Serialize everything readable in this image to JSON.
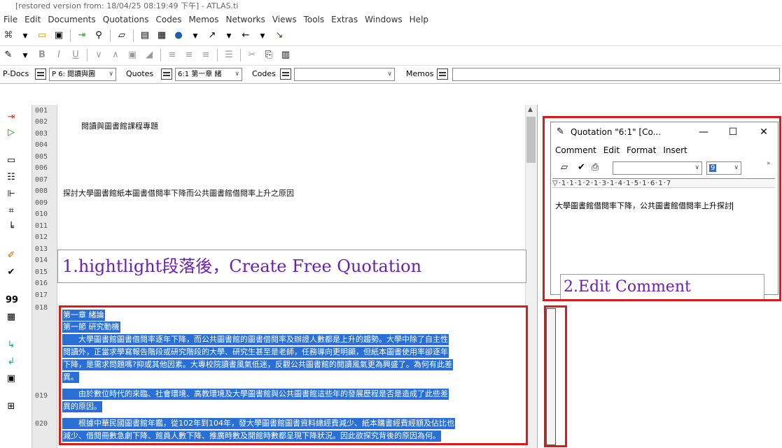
{
  "window": {
    "title": "[restored version from: 18/04/25 08:19:49 下午] - ATLAS.ti"
  },
  "menubar": [
    "File",
    "Edit",
    "Documents",
    "Quotations",
    "Codes",
    "Memos",
    "Networks",
    "Views",
    "Tools",
    "Extras",
    "Windows",
    "Help"
  ],
  "docbar": {
    "pdocs_label": "P-Docs",
    "pdocs_value": "P 6: 閱讀與圖",
    "quotes_label": "Quotes",
    "quotes_value": "6:1 第一章 緒",
    "codes_label": "Codes",
    "codes_value": "",
    "memos_label": "Memos"
  },
  "line_numbers": [
    "001",
    "002",
    "003",
    "004",
    "005",
    "006",
    "007",
    "008",
    "009",
    "010",
    "011",
    "012",
    "013",
    "014",
    "015",
    "016",
    "017",
    "018",
    "019",
    "020"
  ],
  "document": {
    "title_line": "閱讀與圖書館課程專題",
    "subject_line": "探討大學圖書館紙本圖書借閱率下降而公共圖書館借閱率上升之原因",
    "selected_lines": [
      "第一章 緒論",
      "第一節 研究動機",
      "　　大學圖書館圖書借閱率逐年下降，而公共圖書館的圖書借閱率及辦證人數都是上升的趨勢。大學中除了自主性",
      "閱讀外，正當求學寫報告階段或研究階段的大學、研究生甚至是老師，任務導向更明顯，但紙本圖書使用率卻逐年",
      "下降，是需求問題嗎?抑或其他因素。大專校院讀書風氣低迷，反觀公共圖書館的閱讀風氣更為興盛了。為何有此差",
      "異。",
      "　　由於數位時代的來臨、社會環境、高教環境及大學圖書館與公共圖書館這些年的發展歷程是否是造成了此些差",
      "異的原因。",
      "　　根據中華民國圖書館年鑑，從102年到104年，發大學圖書館圖書資料總經費減少、紙本購書經費經額及佔比也",
      "減少、借閱冊數急劇下降、館員人數下降、推廣時數及開館時數都呈現下降狀況。因此欲探究背後的原因為何。"
    ]
  },
  "callouts": {
    "step1": "1.hightlight段落後，Create Free Quotation",
    "step2": "2.Edit Comment"
  },
  "quotation_window": {
    "title": "Quotation \"6:1\" [Co...",
    "menu": [
      "Comment",
      "Edit",
      "Format",
      "Insert"
    ],
    "font_size": "9",
    "ruler": "▽·1·1·1·2·1·3·1·4·1·5·1·6·1·7",
    "comment_text": "大學圖書館借閱率下降，公共圖書館借閱率上升探討"
  },
  "colors": {
    "highlight": "#2a6fd6",
    "annotation_red": "#d91b1b",
    "callout_text": "#6a1fb5"
  }
}
